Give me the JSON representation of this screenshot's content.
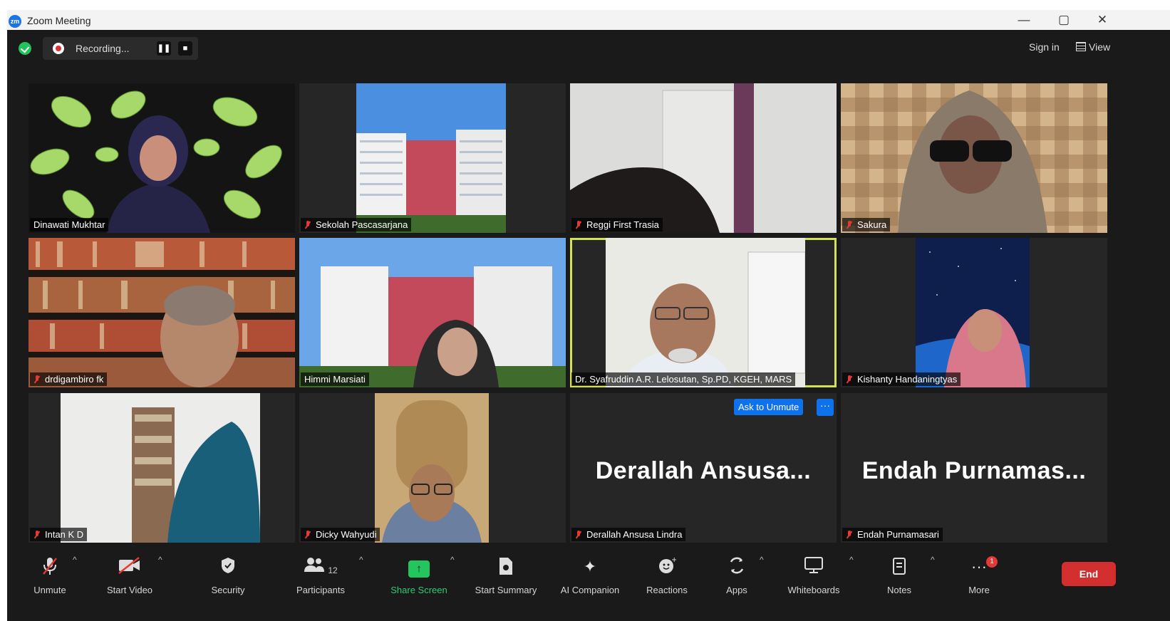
{
  "window": {
    "title": "Zoom Meeting",
    "min": "—",
    "max": "▢",
    "close": "✕",
    "logo": "zm"
  },
  "topbar": {
    "recording_label": "Recording...",
    "pause_symbol": "❚❚",
    "stop_symbol": "■",
    "signin_label": "Sign in",
    "view_label": "View"
  },
  "tiles": [
    {
      "name": "Dinawati Mukhtar",
      "muted": false
    },
    {
      "name": "Sekolah Pascasarjana",
      "muted": true
    },
    {
      "name": "Reggi First Trasia",
      "muted": true
    },
    {
      "name": "Sakura",
      "muted": true
    },
    {
      "name": "drdigambiro fk",
      "muted": true
    },
    {
      "name": "Himmi Marsiati",
      "muted": false
    },
    {
      "name": "Dr. Syafruddin A.R. Lelosutan, Sp.PD, KGEH, MARS",
      "muted": false,
      "active": true
    },
    {
      "name": "Kishanty Handaningtyas",
      "muted": true
    },
    {
      "name": "Intan K D",
      "muted": true
    },
    {
      "name": "Dicky Wahyudi",
      "muted": true
    },
    {
      "name": "Derallah Ansusa Lindra",
      "muted": true,
      "big_name": "Derallah  Ansusa...",
      "ask_label": "Ask to Unmute",
      "more_symbol": "···"
    },
    {
      "name": "Endah Purnamasari",
      "muted": true,
      "big_name": "Endah  Purnamas..."
    }
  ],
  "toolbar": {
    "unmute": "Unmute",
    "start_video": "Start Video",
    "security": "Security",
    "participants": "Participants",
    "participants_count": "12",
    "share_screen": "Share Screen",
    "start_summary": "Start Summary",
    "ai_companion": "AI Companion",
    "reactions": "Reactions",
    "apps": "Apps",
    "whiteboards": "Whiteboards",
    "notes": "Notes",
    "more": "More",
    "more_badge": "1",
    "end": "End",
    "caret": "^"
  },
  "colors": {
    "active_border": "#d4e157",
    "end_red": "#d32f2f",
    "share_green": "#22c55e",
    "ask_blue": "#0e72ed"
  }
}
